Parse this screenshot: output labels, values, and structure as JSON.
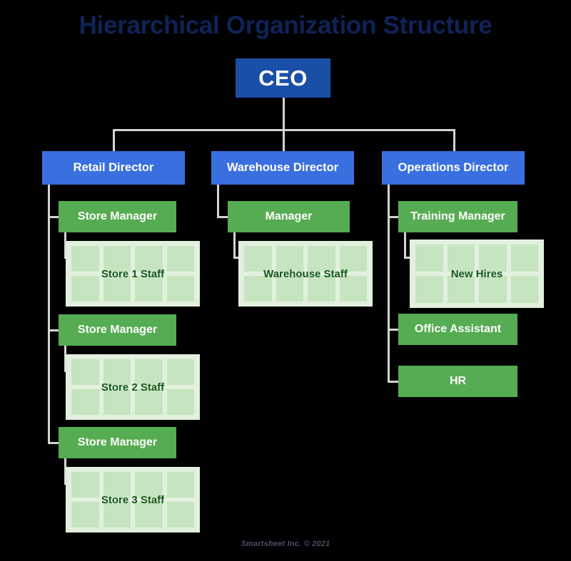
{
  "title": "Hierarchical Organization Structure",
  "footer": "Smartsheet Inc. © 2021",
  "colors": {
    "background": "#000000",
    "title": "#0E2357",
    "ceo_box": "#1A4FA8",
    "director_box": "#3A6FE0",
    "manager_box": "#56AC52",
    "staff_panel": "#E2F0DE",
    "staff_cell": "#C6E4C0",
    "staff_label": "#14571A",
    "connector": "#D4D4D4",
    "footer": "#4A5064"
  },
  "root": {
    "label": "CEO"
  },
  "directors": [
    {
      "label": "Retail Director"
    },
    {
      "label": "Warehouse Director"
    },
    {
      "label": "Operations Director"
    }
  ],
  "managers": [
    {
      "label": "Store Manager"
    },
    {
      "label": "Store Manager"
    },
    {
      "label": "Store Manager"
    },
    {
      "label": "Manager"
    },
    {
      "label": "Training Manager"
    },
    {
      "label": "Office Assistant"
    },
    {
      "label": "HR"
    }
  ],
  "staff_groups": [
    {
      "label": "Store 1 Staff",
      "cells": 8
    },
    {
      "label": "Store 2 Staff",
      "cells": 8
    },
    {
      "label": "Store 3 Staff",
      "cells": 8
    },
    {
      "label": "Warehouse Staff",
      "cells": 8
    },
    {
      "label": "New Hires",
      "cells": 8
    }
  ]
}
